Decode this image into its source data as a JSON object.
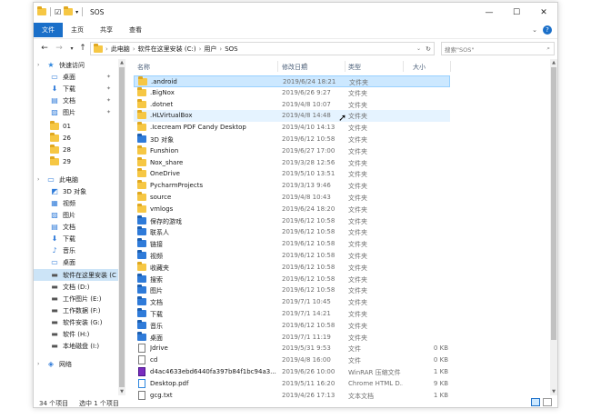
{
  "window": {
    "title": "SOS",
    "controls": {
      "minimize": "—",
      "maximize": "☐",
      "close": "✕"
    }
  },
  "ribbon": {
    "tabs": [
      "文件",
      "主页",
      "共享",
      "查看"
    ],
    "expand": "⌄",
    "help": "?"
  },
  "address": {
    "crumbs": [
      "此电脑",
      "软件在这里安装 (C:)",
      "用户",
      "SOS"
    ],
    "search_placeholder": "搜索\"SOS\""
  },
  "sidebar": {
    "items": [
      {
        "label": "快速访问",
        "icon": "star-icon",
        "color": "#2e86de"
      },
      {
        "label": "桌面",
        "icon": "desktop-icon",
        "pinned": true
      },
      {
        "label": "下载",
        "icon": "download-icon",
        "pinned": true
      },
      {
        "label": "文档",
        "icon": "documents-icon",
        "pinned": true
      },
      {
        "label": "图片",
        "icon": "pictures-icon",
        "pinned": true
      },
      {
        "label": "01",
        "icon": "folder-icon"
      },
      {
        "label": "26",
        "icon": "folder-icon"
      },
      {
        "label": "28",
        "icon": "folder-icon"
      },
      {
        "label": "29",
        "icon": "folder-icon"
      },
      {
        "label": "此电脑",
        "icon": "computer-icon"
      },
      {
        "label": "3D 对象",
        "icon": "3d-objects-icon"
      },
      {
        "label": "视频",
        "icon": "videos-icon"
      },
      {
        "label": "图片",
        "icon": "pictures-icon"
      },
      {
        "label": "文档",
        "icon": "documents-icon"
      },
      {
        "label": "下载",
        "icon": "download-icon"
      },
      {
        "label": "音乐",
        "icon": "music-icon"
      },
      {
        "label": "桌面",
        "icon": "desktop-icon"
      },
      {
        "label": "软件在这里安装 (C",
        "icon": "drive-icon",
        "selected": true
      },
      {
        "label": "文档 (D:)",
        "icon": "drive-icon"
      },
      {
        "label": "工作图片 (E:)",
        "icon": "drive-icon"
      },
      {
        "label": "工作数据 (F:)",
        "icon": "drive-icon"
      },
      {
        "label": "软件安装 (G:)",
        "icon": "drive-icon"
      },
      {
        "label": "软件 (H:)",
        "icon": "drive-icon"
      },
      {
        "label": "本地磁盘 (I:)",
        "icon": "drive-icon"
      },
      {
        "label": "网络",
        "icon": "network-icon"
      }
    ]
  },
  "columns": {
    "name": "名称",
    "date": "修改日期",
    "type": "类型",
    "size": "大小"
  },
  "files": [
    {
      "name": ".android",
      "date": "2019/6/24 18:21",
      "type": "文件夹",
      "size": "",
      "kind": "folder",
      "state": "selected"
    },
    {
      "name": ".BigNox",
      "date": "2019/6/26 9:27",
      "type": "文件夹",
      "size": "",
      "kind": "folder"
    },
    {
      "name": ".dotnet",
      "date": "2019/4/8 10:07",
      "type": "文件夹",
      "size": "",
      "kind": "folder"
    },
    {
      "name": ".HLVirtualBox",
      "date": "2019/4/8 14:48",
      "type": "文件夹",
      "size": "",
      "kind": "folder",
      "state": "hover"
    },
    {
      "name": ".Icecream PDF Candy Desktop",
      "date": "2019/4/10 14:13",
      "type": "文件夹",
      "size": "",
      "kind": "folder"
    },
    {
      "name": "3D 对象",
      "date": "2019/6/12 10:58",
      "type": "文件夹",
      "size": "",
      "kind": "folder-blue"
    },
    {
      "name": "Funshion",
      "date": "2019/6/27 17:00",
      "type": "文件夹",
      "size": "",
      "kind": "folder"
    },
    {
      "name": "Nox_share",
      "date": "2019/3/28 12:56",
      "type": "文件夹",
      "size": "",
      "kind": "folder"
    },
    {
      "name": "OneDrive",
      "date": "2019/5/10 13:51",
      "type": "文件夹",
      "size": "",
      "kind": "folder"
    },
    {
      "name": "PycharmProjects",
      "date": "2019/3/13 9:46",
      "type": "文件夹",
      "size": "",
      "kind": "folder"
    },
    {
      "name": "source",
      "date": "2019/4/8 10:43",
      "type": "文件夹",
      "size": "",
      "kind": "folder"
    },
    {
      "name": "vmlogs",
      "date": "2019/6/24 18:20",
      "type": "文件夹",
      "size": "",
      "kind": "folder"
    },
    {
      "name": "保存的游戏",
      "date": "2019/6/12 10:58",
      "type": "文件夹",
      "size": "",
      "kind": "folder-blue"
    },
    {
      "name": "联系人",
      "date": "2019/6/12 10:58",
      "type": "文件夹",
      "size": "",
      "kind": "folder-blue"
    },
    {
      "name": "链接",
      "date": "2019/6/12 10:58",
      "type": "文件夹",
      "size": "",
      "kind": "folder-blue"
    },
    {
      "name": "视频",
      "date": "2019/6/12 10:58",
      "type": "文件夹",
      "size": "",
      "kind": "folder-blue"
    },
    {
      "name": "收藏夹",
      "date": "2019/6/12 10:58",
      "type": "文件夹",
      "size": "",
      "kind": "folder"
    },
    {
      "name": "搜索",
      "date": "2019/6/12 10:58",
      "type": "文件夹",
      "size": "",
      "kind": "folder-blue"
    },
    {
      "name": "图片",
      "date": "2019/6/12 10:58",
      "type": "文件夹",
      "size": "",
      "kind": "folder-blue"
    },
    {
      "name": "文档",
      "date": "2019/7/1 10:45",
      "type": "文件夹",
      "size": "",
      "kind": "folder-blue"
    },
    {
      "name": "下载",
      "date": "2019/7/1 14:21",
      "type": "文件夹",
      "size": "",
      "kind": "folder-blue"
    },
    {
      "name": "音乐",
      "date": "2019/6/12 10:58",
      "type": "文件夹",
      "size": "",
      "kind": "folder-blue"
    },
    {
      "name": "桌面",
      "date": "2019/7/1 11:19",
      "type": "文件夹",
      "size": "",
      "kind": "folder-blue"
    },
    {
      "name": "Jdrive",
      "date": "2019/5/31 9:53",
      "type": "文件",
      "size": "0 KB",
      "kind": "doc"
    },
    {
      "name": "cd",
      "date": "2019/4/8 16:00",
      "type": "文件",
      "size": "0 KB",
      "kind": "doc"
    },
    {
      "name": "d4ac4633ebd6440fa397b84f1bc94a3...",
      "date": "2019/6/26 10:00",
      "type": "WinRAR 压缩文件",
      "size": "1 KB",
      "kind": "rar"
    },
    {
      "name": "Desktop.pdf",
      "date": "2019/5/11 16:20",
      "type": "Chrome HTML D...",
      "size": "9 KB",
      "kind": "htm"
    },
    {
      "name": "gcg.txt",
      "date": "2019/4/26 17:13",
      "type": "文本文档",
      "size": "1 KB",
      "kind": "doc"
    }
  ],
  "status": {
    "count": "34 个项目",
    "selection": "选中 1 个项目"
  }
}
